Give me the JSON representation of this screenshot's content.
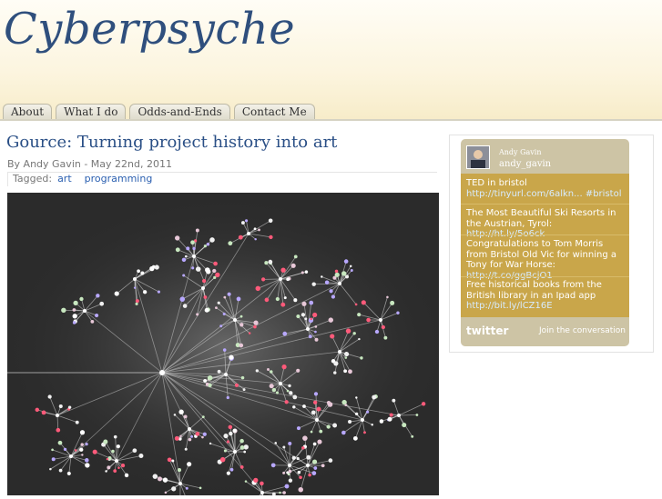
{
  "site": {
    "title": "Cyberpsyche"
  },
  "nav": {
    "items": [
      "About",
      "What I do",
      "Odds-and-Ends",
      "Contact Me"
    ]
  },
  "post": {
    "title": "Gource: Turning project history into art",
    "byline": "By Andy Gavin - May 22nd, 2011",
    "tagged_label": "Tagged:",
    "tags": [
      "art",
      "programming"
    ]
  },
  "twitter_widget": {
    "name": "Andy Gavin",
    "handle": "andy_gavin",
    "tweets": [
      {
        "text": "TED in bristol",
        "link": "http://tinyurl.com/6alkn... #bristol"
      },
      {
        "text": "The Most Beautiful Ski Resorts in the Austrian, Tyrol:",
        "link": "http://ht.ly/5o6ck"
      },
      {
        "text": "Congratulations to Tom Morris from Bristol Old Vic for winning a Tony for War Horse:",
        "link": "http://t.co/ggBcjO1"
      },
      {
        "text": "Free historical books from the British library in an Ipad app",
        "link": "http://bit.ly/lCZ16E"
      }
    ],
    "logo": "twitter",
    "join": "Join the conversation"
  },
  "colors": {
    "title": "#2f4f7d",
    "post_title": "#2a4f86",
    "widget_gold": "#c9a64a",
    "widget_tan": "#cdc4a5"
  }
}
